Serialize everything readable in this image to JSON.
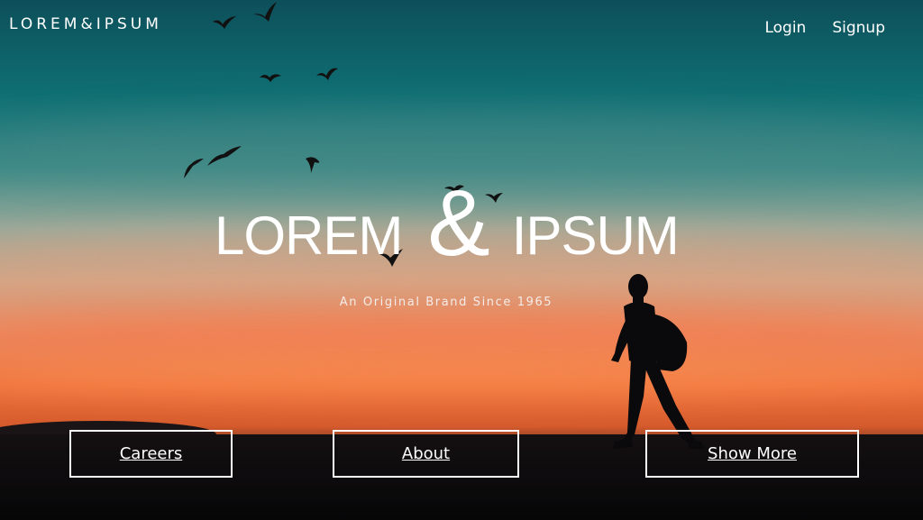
{
  "header": {
    "logo": "LOREM&IPSUM",
    "nav": [
      {
        "label": "Login"
      },
      {
        "label": "Signup"
      }
    ]
  },
  "hero": {
    "title_left": "LOREM",
    "title_amp": "&",
    "title_right": "IPSUM",
    "subtitle": "An Original Brand Since 1965",
    "background_image": "sunset-silhouette-walker-with-birds"
  },
  "buttons": [
    {
      "label": "Careers"
    },
    {
      "label": "About"
    },
    {
      "label": "Show More"
    }
  ],
  "colors": {
    "sky_top": "#0d4f5a",
    "sky_mid": "#0f6f73",
    "sunset": "#f0733e",
    "text": "#ffffff"
  }
}
